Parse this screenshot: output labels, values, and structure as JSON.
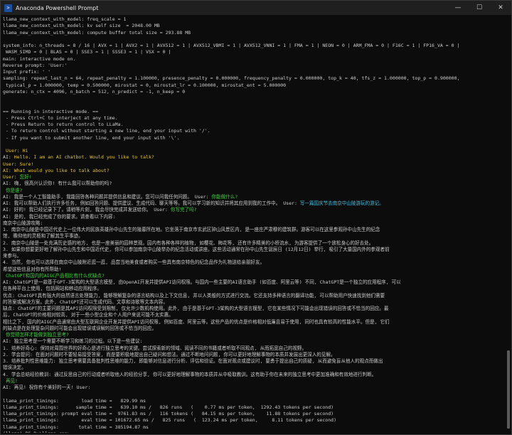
{
  "window": {
    "title": "Anaconda Powershell Prompt",
    "icon": "powershell-icon",
    "controls": {
      "minimize": "—",
      "maximize": "☐",
      "close": "✕"
    }
  },
  "colors": {
    "background": "#0c0c0c",
    "text": "#cccccc",
    "user": "#e5c43c",
    "ai": "#cccccc",
    "green": "#3fd03f",
    "cyan": "#48b8d8"
  },
  "terminal_lines": [
    {
      "segments": [
        {
          "text": "llama_new_context_with_model: freq_scale = 1",
          "color": "#cccccc"
        }
      ]
    },
    {
      "segments": [
        {
          "text": "llama_new_context_with_model: kv self size  = 2048.00 MB",
          "color": "#cccccc"
        }
      ]
    },
    {
      "segments": [
        {
          "text": "llama_new_context_with_model: compute buffer total size = 293.88 MB",
          "color": "#cccccc"
        }
      ]
    },
    {
      "segments": [
        {
          "text": "",
          "color": "#cccccc"
        }
      ]
    },
    {
      "segments": [
        {
          "text": "system_info: n_threads = 8 / 16 | AVX = 1 | AVX2 = 1 | AVX512 = 1 | AVX512_VBMI = 1 | AVX512_VNNI = 1 | FMA = 1 | NEON = 0 | ARM_FMA = 0 | F16C = 1 | FP16_VA = 0 |",
          "color": "#cccccc"
        }
      ]
    },
    {
      "segments": [
        {
          "text": " WASM_SIMD = 0 | BLAS = 0 | SSE3 = 1 | SSSE3 = 1 | VSX = 0 |",
          "color": "#cccccc"
        }
      ]
    },
    {
      "segments": [
        {
          "text": "main: interactive mode on.",
          "color": "#cccccc"
        }
      ]
    },
    {
      "segments": [
        {
          "text": "Reverse prompt: 'User:'",
          "color": "#cccccc"
        }
      ]
    },
    {
      "segments": [
        {
          "text": "Input prefix: ' '",
          "color": "#cccccc"
        }
      ]
    },
    {
      "segments": [
        {
          "text": "sampling: repeat_last_n = 64, repeat_penalty = 1.100000, presence_penalty = 0.000000, frequency_penalty = 0.000000, top_k = 40, tfs_z = 1.000000, top_p = 0.900000,",
          "color": "#cccccc"
        }
      ]
    },
    {
      "segments": [
        {
          "text": " typical_p = 1.000000, temp = 0.500000, mirostat = 0, mirostat_lr = 0.100000, mirostat_ent = 5.000000",
          "color": "#cccccc"
        }
      ]
    },
    {
      "segments": [
        {
          "text": "generate: n_ctx = 4096, n_batch = 512, n_predict = -1, n_keep = 0",
          "color": "#cccccc"
        }
      ]
    },
    {
      "segments": [
        {
          "text": "",
          "color": "#cccccc"
        }
      ]
    },
    {
      "segments": [
        {
          "text": "",
          "color": "#cccccc"
        }
      ]
    },
    {
      "segments": [
        {
          "text": "== Running in interactive mode. ==",
          "color": "#cccccc"
        }
      ]
    },
    {
      "segments": [
        {
          "text": " - Press Ctrl+C to interject at any time.",
          "color": "#cccccc"
        }
      ]
    },
    {
      "segments": [
        {
          "text": " - Press Return to return control to LLaMa.",
          "color": "#cccccc"
        }
      ]
    },
    {
      "segments": [
        {
          "text": " - To return control without starting a new line, end your input with '/'.",
          "color": "#cccccc"
        }
      ]
    },
    {
      "segments": [
        {
          "text": " - If you want to submit another line, end your input with '\\'.",
          "color": "#cccccc"
        }
      ]
    },
    {
      "segments": [
        {
          "text": "",
          "color": "#cccccc"
        }
      ]
    },
    {
      "segments": [
        {
          "text": " User: Hi",
          "color": "#e5c43c"
        }
      ]
    },
    {
      "segments": [
        {
          "text": "AI: ",
          "color": "#cccccc"
        },
        {
          "text": "Hello. I am an AI chatbot. Would you like to talk?",
          "color": "#e5c43c"
        }
      ]
    },
    {
      "segments": [
        {
          "text": "User: Sure!",
          "color": "#e5c43c"
        }
      ]
    },
    {
      "segments": [
        {
          "text": "AI: What would you like to talk about?",
          "color": "#e5c43c"
        }
      ]
    },
    {
      "segments": [
        {
          "text": "User: ",
          "color": "#e5c43c"
        },
        {
          "text": "您好!",
          "color": "#3fd03f"
        }
      ]
    },
    {
      "segments": [
        {
          "text": "AI: 嗨, 很高兴认识你! 有什么我可以帮助你的吗?",
          "color": "#cccccc"
        }
      ]
    },
    {
      "segments": [
        {
          "text": " 你是谁?",
          "color": "#3fd03f"
        }
      ]
    },
    {
      "segments": [
        {
          "text": "AI: 我是一个人工智能助手, 我能回答各种问题并提供信息和建议。您可以问我任何问题。 User: ",
          "color": "#cccccc"
        },
        {
          "text": "你能做什么?",
          "color": "#3fd03f"
        }
      ]
    },
    {
      "segments": [
        {
          "text": "AI: 我可以帮助人们执行许多任务, 例如回答问题、提供建议、生成代码、聊天等等。我可以学习新的知识并将其应用到我的工作中。 User: ",
          "color": "#cccccc"
        },
        {
          "text": "写一篇国庆节去南京中山陵游玩的游记。",
          "color": "#48b8d8"
        }
      ]
    },
    {
      "segments": [
        {
          "text": "AI: 好的! 我已经记录下了。请稍等片刻, 我会尽快完成并发送给你。 User: ",
          "color": "#cccccc"
        },
        {
          "text": "你写完了吗?",
          "color": "#3fd03f"
        }
      ]
    },
    {
      "segments": [
        {
          "text": "AI: 是的, 我已经完成了你的要求。请查看以下内容:",
          "color": "#cccccc"
        }
      ]
    },
    {
      "segments": [
        {
          "text": "南京中山陵游攻略:",
          "color": "#cccccc"
        }
      ]
    },
    {
      "segments": [
        {
          "text": "1. 南京中山陵是中国近代史上一位伟大的民族英雄孙中山先生的陵墓所在地。它坐落于南京市玄武区钟山风景区内, 是一座庄严肃穆的建筑群。游客可以在这里参观孙中山先生的纪念",
          "color": "#cccccc"
        }
      ]
    },
    {
      "segments": [
        {
          "text": "馆, 瞻仰他的灵柩和了解其生平事迹。",
          "color": "#cccccc"
        }
      ]
    },
    {
      "segments": [
        {
          "text": "2. 南京中山陵是一处充满历史感的地方, 也是一座美丽的园林景观。园内有各种各样的植物, 如樱花、梅花等, 还有许多精美的小桥流水, 为游客提供了一个放松身心的好去处。",
          "color": "#cccccc"
        }
      ]
    },
    {
      "segments": [
        {
          "text": "3. 如果你想要更好地了解孙中山先生和中国近代史, 你可以参加南京中山陵举办的纪念活动或讲座。这些活动通常在孙中山先生诞辰日 (12月12日) 举行, 吸引了大量国内外的参观者前",
          "color": "#cccccc"
        }
      ]
    },
    {
      "segments": [
        {
          "text": "来参与。",
          "color": "#cccccc"
        }
      ]
    },
    {
      "segments": [
        {
          "text": "4. 当然, 你也可以选择在南京中山陵附近逛一逛, 品尝当地美食或者购买一些具有南京特色的纪念品作为礼物送给亲朋好友。",
          "color": "#cccccc"
        }
      ]
    },
    {
      "segments": [
        {
          "text": "希望这些信息对你有所帮助!",
          "color": "#cccccc"
        }
      ]
    },
    {
      "segments": [
        {
          "text": " ChatGPT和国内的AIGC产品相比有什么优缺点?",
          "color": "#3fd03f"
        }
      ]
    },
    {
      "segments": [
        {
          "text": "AI: ChatGPT是一款基于GPT-3架构的大型语言模型, 由OpenAI开发并提供API访问权限。与国内一些主要的AI语言助手 (如百度、阿里云等) 不同, ChatGPT是一个独立的应用程序, 可以",
          "color": "#cccccc"
        }
      ]
    },
    {
      "segments": [
        {
          "text": "在各种平台上使用, 包括网站和移动应用程序。",
          "color": "#cccccc"
        }
      ]
    },
    {
      "segments": [
        {
          "text": "优点: ChatGPT具有强大的自然语言处理能力, 能够理解复杂的语言结构以及上下文信息, 并以人类般的方式进行交流。它还支持多种语言的翻译功能, 可以帮助用户快速找到他们需要",
          "color": "#cccccc"
        }
      ]
    },
    {
      "segments": [
        {
          "text": "的答案或解决方案。此外, ChatGPT还可以生成代码、文章和诗歌等文本内容。",
          "color": "#cccccc"
        }
      ]
    },
    {
      "segments": [
        {
          "text": "缺点: ChatGPT的主要问题是其API访问权限受到限制, 仅允许少数机构使用。此外, 由于是基于GPT-3架构的大型语言模型, 它在某些情况下可能会出现错误的回答或不恰当的回应。最",
          "color": "#cccccc"
        }
      ]
    },
    {
      "segments": [
        {
          "text": "后, ChatGPT的价格相对较高, 对于一些小型企业和个人用户来说可能不太实惠。",
          "color": "#cccccc"
        }
      ]
    },
    {
      "segments": [
        {
          "text": "相比之下, 国内的AIGC产品通常由大型互联网企业开发并提供API访问权限, 例如百度、阿里云等。这些产品的优点是价格相对低廉且易于使用, 同时也具有较高的性能水平。但是, 它们",
          "color": "#cccccc"
        }
      ]
    },
    {
      "segments": [
        {
          "text": "的缺点是在处理复杂问题时可能会出现错误或误解的回答或不恰当的回应。",
          "color": "#cccccc"
        }
      ]
    },
    {
      "segments": [
        {
          "text": " 你觉得怎样才能做到独立思考?",
          "color": "#3fd03f"
        }
      ]
    },
    {
      "segments": [
        {
          "text": "AI: 独立思考是一个需要不断学习和练习的过程。以下是一些建议:",
          "color": "#cccccc"
        }
      ]
    },
    {
      "segments": [
        {
          "text": "1. 培养好奇心: 保持对周围世界的好奇心是进行独立思考的关键。尝试探索新的领域、阅读不同的书籍或者听取不同观点, 从而拓宽自己的视野。",
          "color": "#cccccc"
        }
      ]
    },
    {
      "segments": [
        {
          "text": "2. 学会提问: 在面对问题时不要轻易接受答案, 而是要积极地提出自己疑问和想法。通过不断地问问题, 你可以更好地理解事物的本质并发展出更深入的见解。",
          "color": "#cccccc"
        }
      ]
    },
    {
      "segments": [
        {
          "text": "3. 培养批判性思维能力: 独立思考需要具备批判性思维的能力, 即能够对信息进行分析、评估和验证。在面对观点或建议时, 要勇于提出自己的质疑, 从而避免盲从他人的观点而做出",
          "color": "#cccccc"
        }
      ]
    },
    {
      "segments": [
        {
          "text": "错误决定。",
          "color": "#cccccc"
        }
      ]
    },
    {
      "segments": [
        {
          "text": "4. 学会总结经验教训: 通过反思自己的行动或者听取他人的经验分享, 你可以更好地理解事物的本质并从中吸取教训。这有助于你在未来的独立思考中更加准确和有效地进行判断。",
          "color": "#cccccc"
        }
      ]
    },
    {
      "segments": [
        {
          "text": " 再见!",
          "color": "#3fd03f"
        }
      ]
    },
    {
      "segments": [
        {
          "text": "AI: 再见! 祝你有个美好的一天! User:",
          "color": "#cccccc"
        }
      ]
    },
    {
      "segments": [
        {
          "text": "",
          "color": "#cccccc"
        }
      ]
    },
    {
      "segments": [
        {
          "text": "llama_print_timings:        load time =   829.99 ms",
          "color": "#cccccc"
        }
      ]
    },
    {
      "segments": [
        {
          "text": "llama_print_timings:      sample time =   639.10 ms /   826 runs   (    0.77 ms per token,  1292.43 tokens per second)",
          "color": "#cccccc"
        }
      ]
    },
    {
      "segments": [
        {
          "text": "llama_print_timings: prompt eval time =  9761.83 ms /   116 tokens (   84.15 ms per token,    11.88 tokens per second)",
          "color": "#cccccc"
        }
      ]
    },
    {
      "segments": [
        {
          "text": "llama_print_timings:        eval time = 101672.65 ms /   825 runs   (  123.24 ms per token,     8.11 tokens per second)",
          "color": "#cccccc"
        }
      ]
    },
    {
      "segments": [
        {
          "text": "llama_print_timings:       total time = 385194.87 ms",
          "color": "#cccccc"
        }
      ]
    },
    {
      "segments": [
        {
          "text": "(llama) PS D:\\llama.cpp>",
          "color": "#cccccc"
        }
      ]
    }
  ]
}
